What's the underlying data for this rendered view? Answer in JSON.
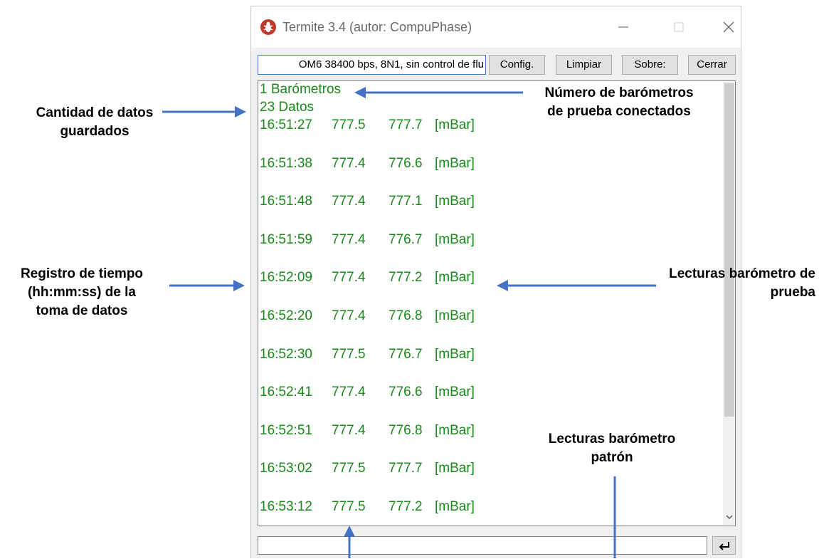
{
  "window": {
    "title": "Termite 3.4 (autor: CompuPhase)",
    "controls": {
      "minimize_icon": "minimize-icon",
      "maximize_icon": "maximize-icon",
      "close_icon": "close-icon"
    }
  },
  "toolbar": {
    "port_settings": "OM6 38400 bps, 8N1, sin control de flu",
    "config_label": "Config.",
    "limpiar_label": "Limpiar",
    "sobre_label": "Sobre:",
    "cerrar_label": "Cerrar"
  },
  "output": {
    "barometers_line": "1 Barómetros",
    "data_count_line": "23 Datos",
    "readings": [
      {
        "time": "16:51:27",
        "test": "777.5",
        "reference": "777.7",
        "unit": "[mBar]"
      },
      {
        "time": "16:51:38",
        "test": "777.4",
        "reference": "776.6",
        "unit": "[mBar]"
      },
      {
        "time": "16:51:48",
        "test": "777.4",
        "reference": "777.1",
        "unit": "[mBar]"
      },
      {
        "time": "16:51:59",
        "test": "777.4",
        "reference": "776.7",
        "unit": "[mBar]"
      },
      {
        "time": "16:52:09",
        "test": "777.4",
        "reference": "777.2",
        "unit": "[mBar]"
      },
      {
        "time": "16:52:20",
        "test": "777.4",
        "reference": "776.8",
        "unit": "[mBar]"
      },
      {
        "time": "16:52:30",
        "test": "777.5",
        "reference": "776.7",
        "unit": "[mBar]"
      },
      {
        "time": "16:52:41",
        "test": "777.4",
        "reference": "776.6",
        "unit": "[mBar]"
      },
      {
        "time": "16:52:51",
        "test": "777.4",
        "reference": "776.8",
        "unit": "[mBar]"
      },
      {
        "time": "16:53:02",
        "test": "777.5",
        "reference": "777.7",
        "unit": "[mBar]"
      },
      {
        "time": "16:53:12",
        "test": "777.5",
        "reference": "777.2",
        "unit": "[mBar]"
      }
    ]
  },
  "input": {
    "value": "",
    "send_icon": "enter-icon"
  },
  "annotations": {
    "data_count": [
      "Cantidad de datos",
      "guardados"
    ],
    "barometers": [
      "Número de barómetros",
      "de prueba conectados"
    ],
    "timestamp": [
      "Registro de tiempo",
      "(hh:mm:ss) de la",
      "toma de datos"
    ],
    "test_readings": [
      "Lecturas barómetro de",
      "prueba"
    ],
    "reference_readings": [
      "Lecturas barómetro",
      "patrón"
    ]
  },
  "colors": {
    "output_text": "#1a8a1a",
    "annotation_arrow": "#4472c4",
    "port_field_border": "#3c7fc8"
  }
}
